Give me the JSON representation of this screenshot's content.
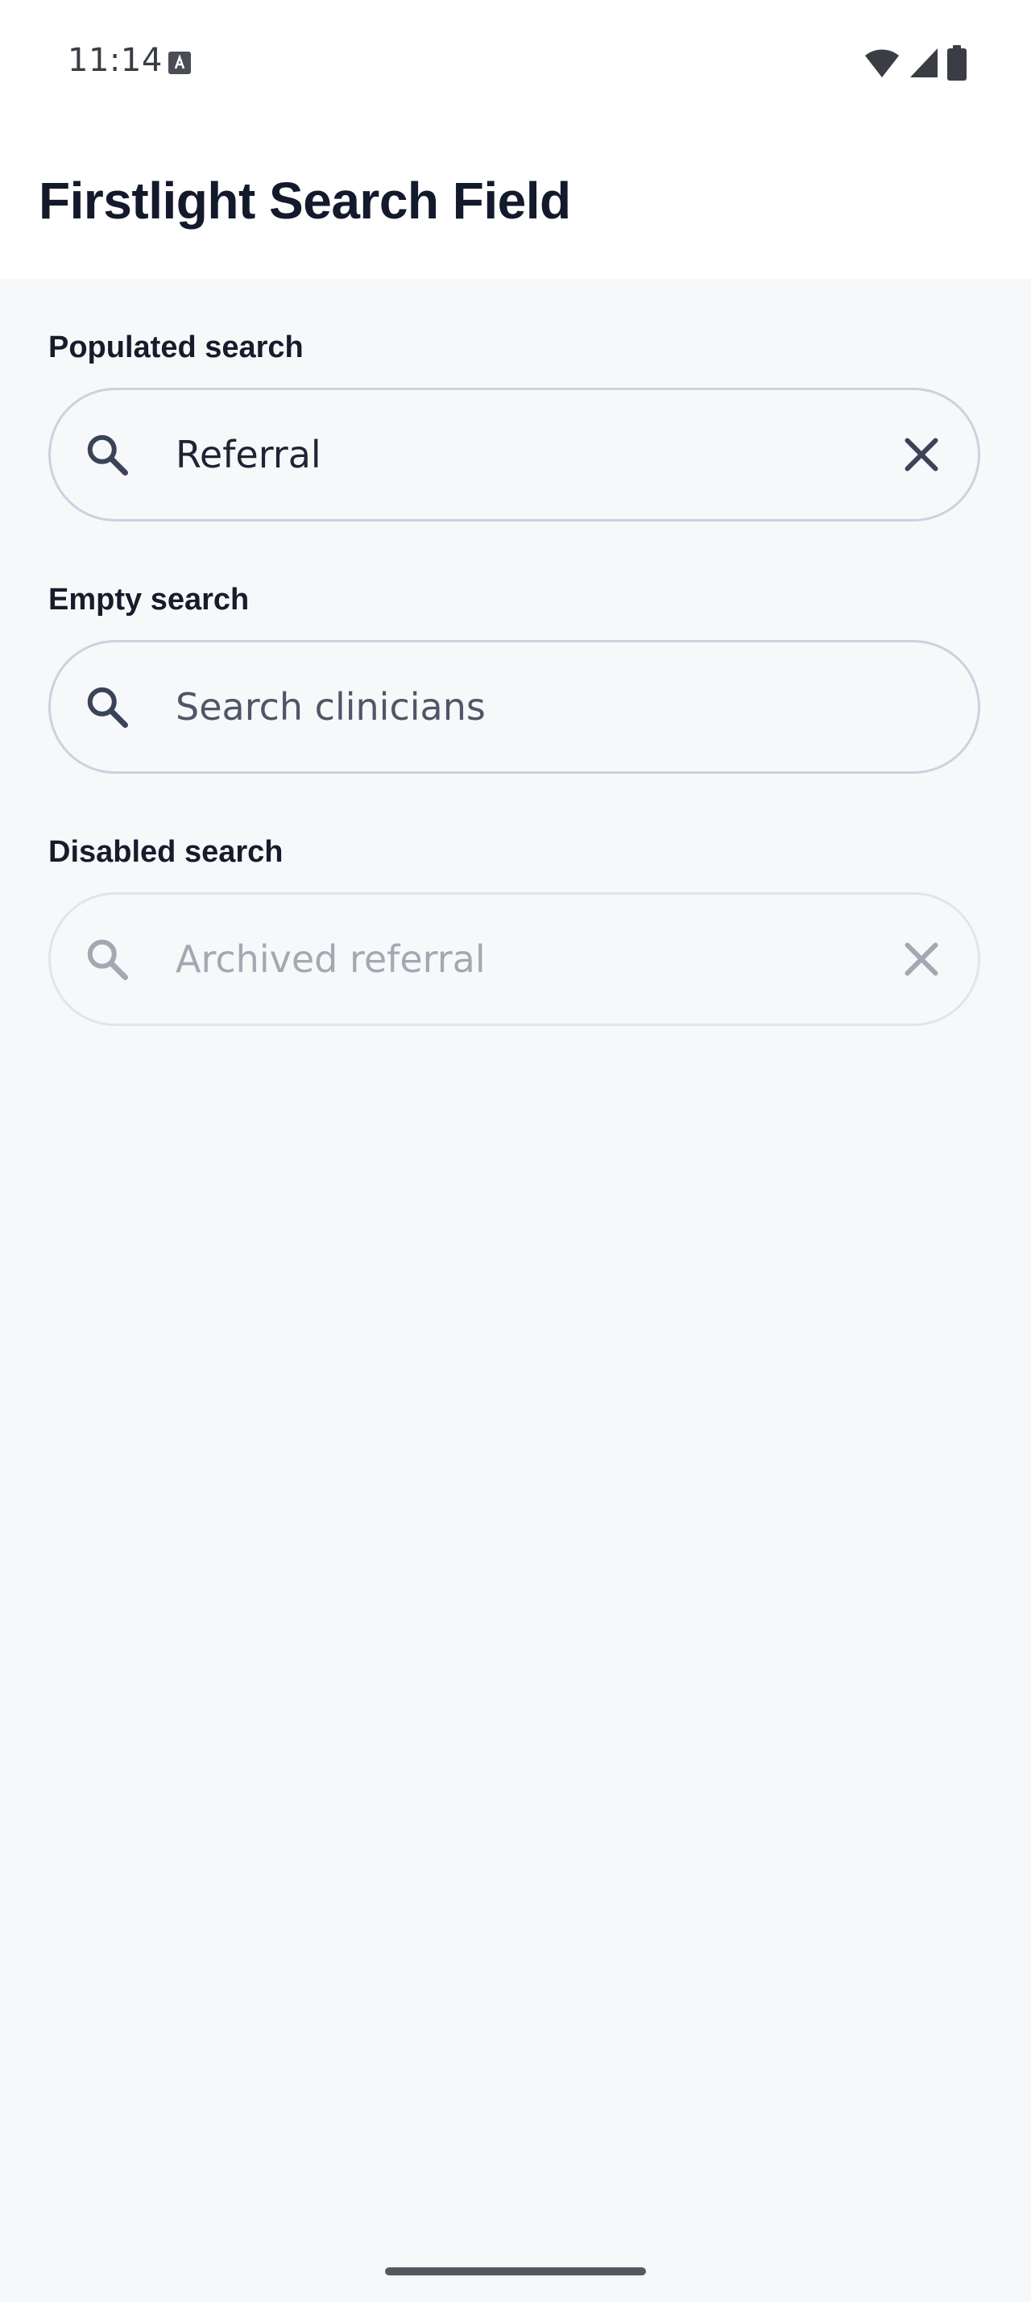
{
  "status_bar": {
    "time": "11:14",
    "icons": [
      "keyboard-notification-icon",
      "wifi-icon",
      "cellular-signal-icon",
      "battery-icon"
    ]
  },
  "app_bar": {
    "title": "Firstlight Search Field"
  },
  "sections": [
    {
      "label": "Populated search",
      "value": "Referral",
      "placeholder": "",
      "state": "populated",
      "has_clear": true
    },
    {
      "label": "Empty search",
      "value": "",
      "placeholder": "Search clinicians",
      "state": "empty",
      "has_clear": false
    },
    {
      "label": "Disabled search",
      "value": "Archived referral",
      "placeholder": "",
      "state": "disabled",
      "has_clear": true
    }
  ],
  "colors": {
    "background": "#f7f8fa",
    "surface": "#ffffff",
    "title_text": "#131a2b",
    "field_border": "#cdd1de",
    "icon_active": "#3b4358",
    "icon_disabled": "#a4a8b2"
  }
}
